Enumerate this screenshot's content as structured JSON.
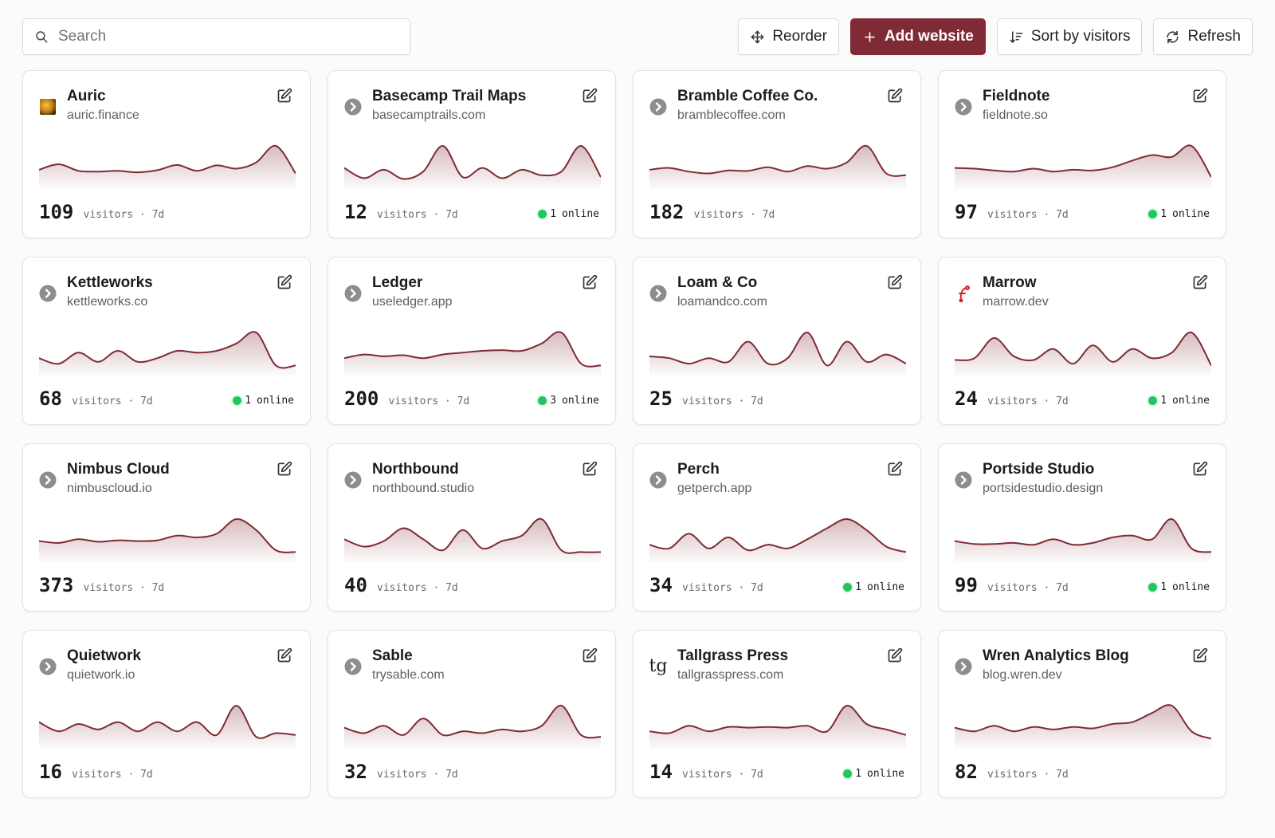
{
  "toolbar": {
    "search_placeholder": "Search",
    "reorder_label": "Reorder",
    "add_label": "Add website",
    "sort_label": "Sort by visitors",
    "refresh_label": "Refresh"
  },
  "colors": {
    "accent": "#7f2a34",
    "online": "#22c55e"
  },
  "period_label": "visitors · 7d",
  "online_suffix": "online",
  "sites": [
    {
      "name": "Auric",
      "domain": "auric.finance",
      "visitors": "109",
      "online": null,
      "favicon": "auric-logo",
      "trend": [
        0.35,
        0.5,
        0.32,
        0.3,
        0.32,
        0.28,
        0.34,
        0.48,
        0.32,
        0.47,
        0.38,
        0.55,
        1.0,
        0.25
      ]
    },
    {
      "name": "Basecamp Trail Maps",
      "domain": "basecamptrails.com",
      "visitors": "12",
      "online": "1",
      "favicon": "globe-icon",
      "trend": [
        0.4,
        0.12,
        0.35,
        0.1,
        0.3,
        1.0,
        0.15,
        0.4,
        0.12,
        0.35,
        0.2,
        0.3,
        1.0,
        0.15
      ]
    },
    {
      "name": "Bramble Coffee Co.",
      "domain": "bramblecoffee.com",
      "visitors": "182",
      "online": null,
      "favicon": "globe-icon",
      "trend": [
        0.35,
        0.4,
        0.3,
        0.25,
        0.33,
        0.32,
        0.42,
        0.3,
        0.45,
        0.38,
        0.55,
        1.0,
        0.25,
        0.2
      ]
    },
    {
      "name": "Fieldnote",
      "domain": "fieldnote.so",
      "visitors": "97",
      "online": "1",
      "favicon": "globe-icon",
      "trend": [
        0.4,
        0.38,
        0.33,
        0.3,
        0.38,
        0.3,
        0.35,
        0.33,
        0.42,
        0.6,
        0.75,
        0.7,
        1.0,
        0.15
      ]
    },
    {
      "name": "Kettleworks",
      "domain": "kettleworks.co",
      "visitors": "68",
      "online": "1",
      "favicon": "globe-icon",
      "trend": [
        0.3,
        0.15,
        0.45,
        0.2,
        0.5,
        0.2,
        0.3,
        0.5,
        0.45,
        0.5,
        0.7,
        1.0,
        0.1,
        0.1
      ]
    },
    {
      "name": "Ledger",
      "domain": "useledger.app",
      "visitors": "200",
      "online": "3",
      "favicon": "globe-icon",
      "trend": [
        0.3,
        0.4,
        0.35,
        0.38,
        0.3,
        0.4,
        0.45,
        0.5,
        0.52,
        0.5,
        0.7,
        1.0,
        0.15,
        0.1
      ]
    },
    {
      "name": "Loam & Co",
      "domain": "loamandco.com",
      "visitors": "25",
      "online": null,
      "favicon": "globe-icon",
      "trend": [
        0.35,
        0.3,
        0.15,
        0.3,
        0.2,
        0.75,
        0.15,
        0.3,
        1.0,
        0.1,
        0.75,
        0.2,
        0.4,
        0.15
      ]
    },
    {
      "name": "Marrow",
      "domain": "marrow.dev",
      "visitors": "24",
      "online": "1",
      "favicon": "marrow-logo",
      "trend": [
        0.25,
        0.3,
        0.85,
        0.35,
        0.25,
        0.55,
        0.15,
        0.65,
        0.2,
        0.55,
        0.3,
        0.45,
        1.0,
        0.1
      ]
    },
    {
      "name": "Nimbus Cloud",
      "domain": "nimbuscloud.io",
      "visitors": "373",
      "online": null,
      "favicon": "globe-icon",
      "trend": [
        0.4,
        0.35,
        0.45,
        0.38,
        0.42,
        0.4,
        0.42,
        0.55,
        0.5,
        0.6,
        1.0,
        0.7,
        0.15,
        0.1
      ]
    },
    {
      "name": "Northbound",
      "domain": "northbound.studio",
      "visitors": "40",
      "online": null,
      "favicon": "globe-icon",
      "trend": [
        0.45,
        0.25,
        0.4,
        0.75,
        0.45,
        0.15,
        0.7,
        0.2,
        0.4,
        0.55,
        1.0,
        0.15,
        0.1,
        0.1
      ]
    },
    {
      "name": "Perch",
      "domain": "getperch.app",
      "visitors": "34",
      "online": "1",
      "favicon": "globe-icon",
      "trend": [
        0.3,
        0.2,
        0.6,
        0.2,
        0.5,
        0.15,
        0.3,
        0.2,
        0.45,
        0.75,
        1.0,
        0.7,
        0.25,
        0.1
      ]
    },
    {
      "name": "Portside Studio",
      "domain": "portsidestudio.design",
      "visitors": "99",
      "online": "1",
      "favicon": "globe-icon",
      "trend": [
        0.4,
        0.32,
        0.32,
        0.35,
        0.3,
        0.45,
        0.3,
        0.35,
        0.5,
        0.55,
        0.45,
        1.0,
        0.2,
        0.1
      ]
    },
    {
      "name": "Quietwork",
      "domain": "quietwork.io",
      "visitors": "16",
      "online": null,
      "favicon": "globe-icon",
      "trend": [
        0.55,
        0.3,
        0.5,
        0.35,
        0.55,
        0.3,
        0.55,
        0.3,
        0.55,
        0.2,
        1.0,
        0.15,
        0.25,
        0.2
      ]
    },
    {
      "name": "Sable",
      "domain": "trysable.com",
      "visitors": "32",
      "online": null,
      "favicon": "globe-icon",
      "trend": [
        0.4,
        0.25,
        0.45,
        0.2,
        0.65,
        0.2,
        0.3,
        0.25,
        0.35,
        0.3,
        0.45,
        1.0,
        0.2,
        0.15
      ]
    },
    {
      "name": "Tallgrass Press",
      "domain": "tallgrasspress.com",
      "visitors": "14",
      "online": "1",
      "favicon": "tg-logo",
      "trend": [
        0.3,
        0.25,
        0.45,
        0.3,
        0.42,
        0.4,
        0.42,
        0.4,
        0.45,
        0.3,
        1.0,
        0.5,
        0.35,
        0.2
      ]
    },
    {
      "name": "Wren Analytics Blog",
      "domain": "blog.wren.dev",
      "visitors": "82",
      "online": null,
      "favicon": "globe-icon",
      "trend": [
        0.4,
        0.3,
        0.45,
        0.3,
        0.42,
        0.35,
        0.42,
        0.38,
        0.5,
        0.55,
        0.8,
        1.0,
        0.3,
        0.1
      ]
    }
  ]
}
